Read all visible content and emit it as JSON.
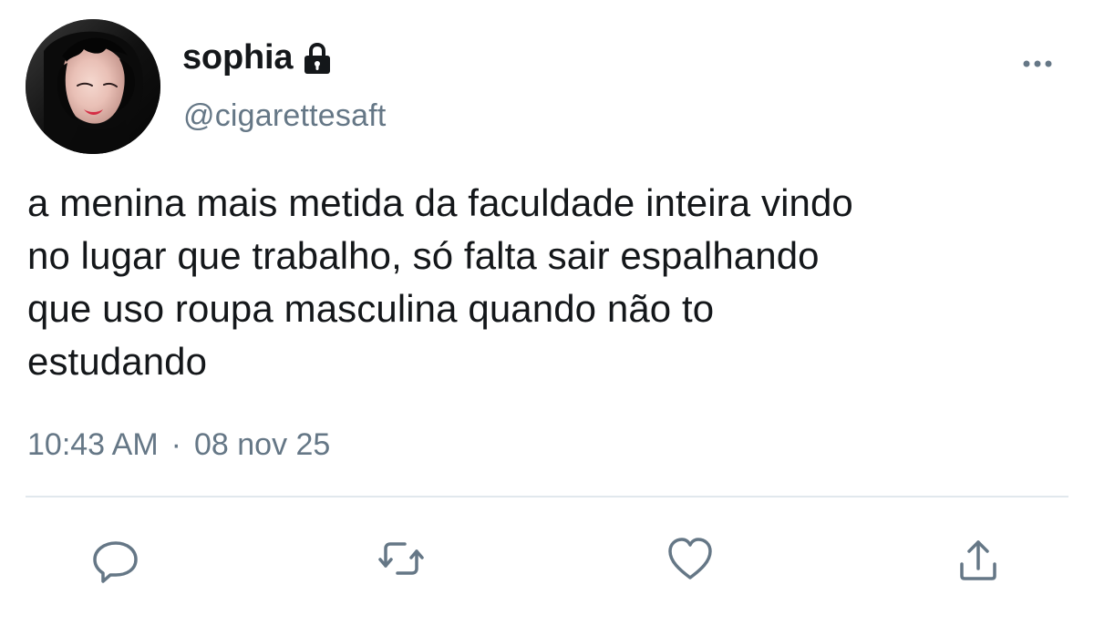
{
  "author": {
    "display_name": "sophia",
    "handle": "@cigarettesaft",
    "avatar_icon": "profile-photo",
    "protected_icon": "lock-icon"
  },
  "tweet": {
    "text": "a menina mais metida da faculdade inteira vindo\nno lugar que trabalho, só falta sair espalhando\nque uso roupa masculina quando não to\nestudando",
    "time": "10:43 AM",
    "separator": "·",
    "date": "08 nov 25"
  },
  "actions": {
    "more_icon": "more-icon",
    "reply_icon": "reply-icon",
    "retweet_icon": "retweet-icon",
    "like_icon": "heart-icon",
    "share_icon": "share-icon"
  },
  "colors": {
    "primary_text": "#14171a",
    "secondary_text": "#657786",
    "divider": "#e1e8ed",
    "background": "#ffffff"
  }
}
